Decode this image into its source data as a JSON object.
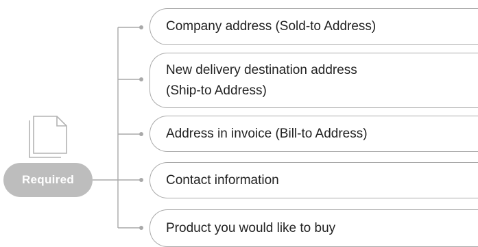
{
  "badge": {
    "label": "Required"
  },
  "icons": {
    "document": "document-copy-icon"
  },
  "items": [
    {
      "label": "Company  address  (Sold-to  Address)"
    },
    {
      "label": "New delivery destination address\n(Ship-to  Address)"
    },
    {
      "label": "Address in invoice (Bill-to Address)"
    },
    {
      "label": "Contact  information"
    },
    {
      "label": "Product  you would like to buy"
    }
  ],
  "colors": {
    "line": "#a9a9a9",
    "badge": "#bdbdbd",
    "badge_text": "#ffffff",
    "text": "#222222"
  }
}
